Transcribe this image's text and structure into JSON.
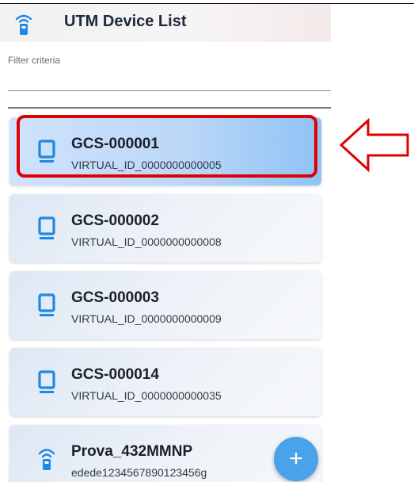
{
  "app_bar": {
    "title": "UTM Device List",
    "icon": "wireless-device-icon"
  },
  "filter": {
    "label": "Filter criteria",
    "value": "",
    "placeholder": ""
  },
  "devices": [
    {
      "name": "GCS-000001",
      "id": "VIRTUAL_ID_0000000000005",
      "icon": "monitor-icon",
      "selected": true
    },
    {
      "name": "GCS-000002",
      "id": "VIRTUAL_ID_0000000000008",
      "icon": "monitor-icon",
      "selected": false
    },
    {
      "name": "GCS-000003",
      "id": "VIRTUAL_ID_0000000000009",
      "icon": "monitor-icon",
      "selected": false
    },
    {
      "name": "GCS-000014",
      "id": "VIRTUAL_ID_0000000000035",
      "icon": "monitor-icon",
      "selected": false
    },
    {
      "name": "Prova_432MMNP",
      "id": "edede1234567890123456g",
      "icon": "wireless-device-icon",
      "selected": false
    }
  ],
  "fab": {
    "label": "+"
  },
  "colors": {
    "accent": "#4aa3ea",
    "device_icon": "#1e88e5",
    "highlight": "#e00000"
  }
}
